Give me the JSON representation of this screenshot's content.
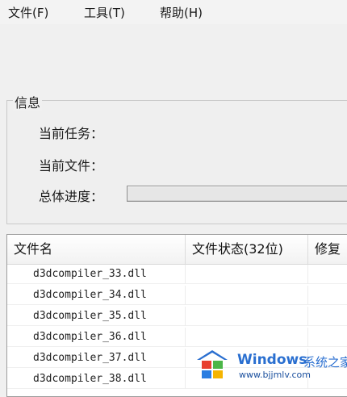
{
  "menu": {
    "file": "文件(F)",
    "tools": "工具(T)",
    "help": "帮助(H)"
  },
  "info": {
    "group_title": "信息",
    "current_task_label": "当前任务：",
    "current_file_label": "当前文件：",
    "overall_progress_label": "总体进度：",
    "overall_progress": 0
  },
  "list": {
    "columns": [
      "文件名",
      "文件状态(32位)",
      "修复"
    ],
    "rows": [
      {
        "name": "d3dcompiler_33.dll",
        "status": "",
        "repair": ""
      },
      {
        "name": "d3dcompiler_34.dll",
        "status": "",
        "repair": ""
      },
      {
        "name": "d3dcompiler_35.dll",
        "status": "",
        "repair": ""
      },
      {
        "name": "d3dcompiler_36.dll",
        "status": "",
        "repair": ""
      },
      {
        "name": "d3dcompiler_37.dll",
        "status": "",
        "repair": ""
      },
      {
        "name": "d3dcompiler_38.dll",
        "status": "",
        "repair": ""
      }
    ]
  },
  "watermark": {
    "brand": "Windows",
    "cn": "系统之家",
    "url": "www.bjjmlv.com"
  }
}
